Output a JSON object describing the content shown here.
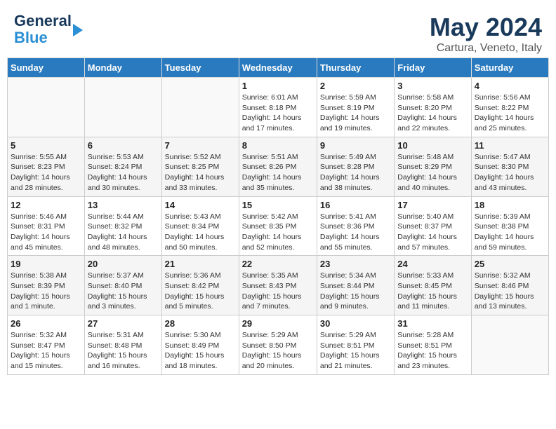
{
  "header": {
    "logo_line1": "General",
    "logo_line2": "Blue",
    "title": "May 2024",
    "subtitle": "Cartura, Veneto, Italy"
  },
  "days_of_week": [
    "Sunday",
    "Monday",
    "Tuesday",
    "Wednesday",
    "Thursday",
    "Friday",
    "Saturday"
  ],
  "weeks": [
    [
      {
        "day": "",
        "info": ""
      },
      {
        "day": "",
        "info": ""
      },
      {
        "day": "",
        "info": ""
      },
      {
        "day": "1",
        "info": "Sunrise: 6:01 AM\nSunset: 8:18 PM\nDaylight: 14 hours and 17 minutes."
      },
      {
        "day": "2",
        "info": "Sunrise: 5:59 AM\nSunset: 8:19 PM\nDaylight: 14 hours and 19 minutes."
      },
      {
        "day": "3",
        "info": "Sunrise: 5:58 AM\nSunset: 8:20 PM\nDaylight: 14 hours and 22 minutes."
      },
      {
        "day": "4",
        "info": "Sunrise: 5:56 AM\nSunset: 8:22 PM\nDaylight: 14 hours and 25 minutes."
      }
    ],
    [
      {
        "day": "5",
        "info": "Sunrise: 5:55 AM\nSunset: 8:23 PM\nDaylight: 14 hours and 28 minutes."
      },
      {
        "day": "6",
        "info": "Sunrise: 5:53 AM\nSunset: 8:24 PM\nDaylight: 14 hours and 30 minutes."
      },
      {
        "day": "7",
        "info": "Sunrise: 5:52 AM\nSunset: 8:25 PM\nDaylight: 14 hours and 33 minutes."
      },
      {
        "day": "8",
        "info": "Sunrise: 5:51 AM\nSunset: 8:26 PM\nDaylight: 14 hours and 35 minutes."
      },
      {
        "day": "9",
        "info": "Sunrise: 5:49 AM\nSunset: 8:28 PM\nDaylight: 14 hours and 38 minutes."
      },
      {
        "day": "10",
        "info": "Sunrise: 5:48 AM\nSunset: 8:29 PM\nDaylight: 14 hours and 40 minutes."
      },
      {
        "day": "11",
        "info": "Sunrise: 5:47 AM\nSunset: 8:30 PM\nDaylight: 14 hours and 43 minutes."
      }
    ],
    [
      {
        "day": "12",
        "info": "Sunrise: 5:46 AM\nSunset: 8:31 PM\nDaylight: 14 hours and 45 minutes."
      },
      {
        "day": "13",
        "info": "Sunrise: 5:44 AM\nSunset: 8:32 PM\nDaylight: 14 hours and 48 minutes."
      },
      {
        "day": "14",
        "info": "Sunrise: 5:43 AM\nSunset: 8:34 PM\nDaylight: 14 hours and 50 minutes."
      },
      {
        "day": "15",
        "info": "Sunrise: 5:42 AM\nSunset: 8:35 PM\nDaylight: 14 hours and 52 minutes."
      },
      {
        "day": "16",
        "info": "Sunrise: 5:41 AM\nSunset: 8:36 PM\nDaylight: 14 hours and 55 minutes."
      },
      {
        "day": "17",
        "info": "Sunrise: 5:40 AM\nSunset: 8:37 PM\nDaylight: 14 hours and 57 minutes."
      },
      {
        "day": "18",
        "info": "Sunrise: 5:39 AM\nSunset: 8:38 PM\nDaylight: 14 hours and 59 minutes."
      }
    ],
    [
      {
        "day": "19",
        "info": "Sunrise: 5:38 AM\nSunset: 8:39 PM\nDaylight: 15 hours and 1 minute."
      },
      {
        "day": "20",
        "info": "Sunrise: 5:37 AM\nSunset: 8:40 PM\nDaylight: 15 hours and 3 minutes."
      },
      {
        "day": "21",
        "info": "Sunrise: 5:36 AM\nSunset: 8:42 PM\nDaylight: 15 hours and 5 minutes."
      },
      {
        "day": "22",
        "info": "Sunrise: 5:35 AM\nSunset: 8:43 PM\nDaylight: 15 hours and 7 minutes."
      },
      {
        "day": "23",
        "info": "Sunrise: 5:34 AM\nSunset: 8:44 PM\nDaylight: 15 hours and 9 minutes."
      },
      {
        "day": "24",
        "info": "Sunrise: 5:33 AM\nSunset: 8:45 PM\nDaylight: 15 hours and 11 minutes."
      },
      {
        "day": "25",
        "info": "Sunrise: 5:32 AM\nSunset: 8:46 PM\nDaylight: 15 hours and 13 minutes."
      }
    ],
    [
      {
        "day": "26",
        "info": "Sunrise: 5:32 AM\nSunset: 8:47 PM\nDaylight: 15 hours and 15 minutes."
      },
      {
        "day": "27",
        "info": "Sunrise: 5:31 AM\nSunset: 8:48 PM\nDaylight: 15 hours and 16 minutes."
      },
      {
        "day": "28",
        "info": "Sunrise: 5:30 AM\nSunset: 8:49 PM\nDaylight: 15 hours and 18 minutes."
      },
      {
        "day": "29",
        "info": "Sunrise: 5:29 AM\nSunset: 8:50 PM\nDaylight: 15 hours and 20 minutes."
      },
      {
        "day": "30",
        "info": "Sunrise: 5:29 AM\nSunset: 8:51 PM\nDaylight: 15 hours and 21 minutes."
      },
      {
        "day": "31",
        "info": "Sunrise: 5:28 AM\nSunset: 8:51 PM\nDaylight: 15 hours and 23 minutes."
      },
      {
        "day": "",
        "info": ""
      }
    ]
  ]
}
